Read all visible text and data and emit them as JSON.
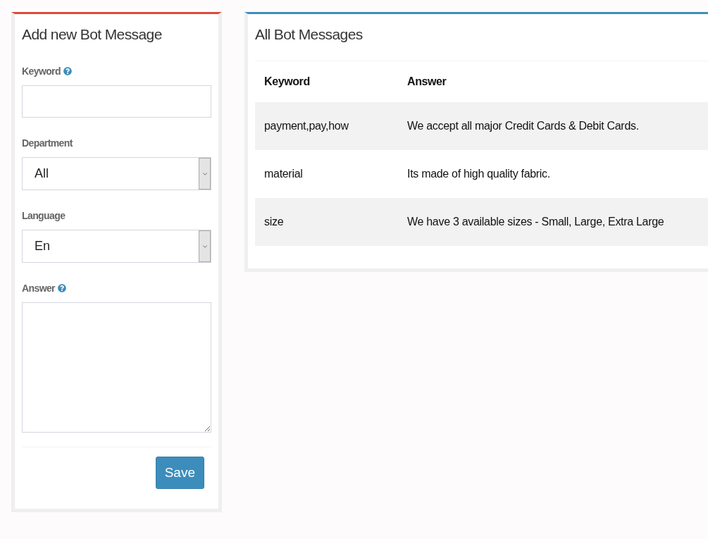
{
  "add_form": {
    "title": "Add new Bot Message",
    "fields": [
      {
        "kind": "text",
        "label": "Keyword",
        "help": true
      },
      {
        "kind": "select",
        "label": "Department",
        "value": "All",
        "help": false
      },
      {
        "kind": "select",
        "label": "Language",
        "value": "En",
        "help": false
      },
      {
        "kind": "textarea",
        "label": "Answer",
        "help": true
      }
    ],
    "save_button": "Save"
  },
  "messages": {
    "title": "All Bot Messages",
    "columns": [
      "Keyword",
      "Answer"
    ],
    "rows": [
      {
        "keyword": "payment,pay,how",
        "answer": "We accept all major Credit Cards & Debit Cards."
      },
      {
        "keyword": "material",
        "answer": "Its made of high quality fabric."
      },
      {
        "keyword": "size",
        "answer": "We have 3 available sizes - Small, Large, Extra Large"
      }
    ]
  }
}
